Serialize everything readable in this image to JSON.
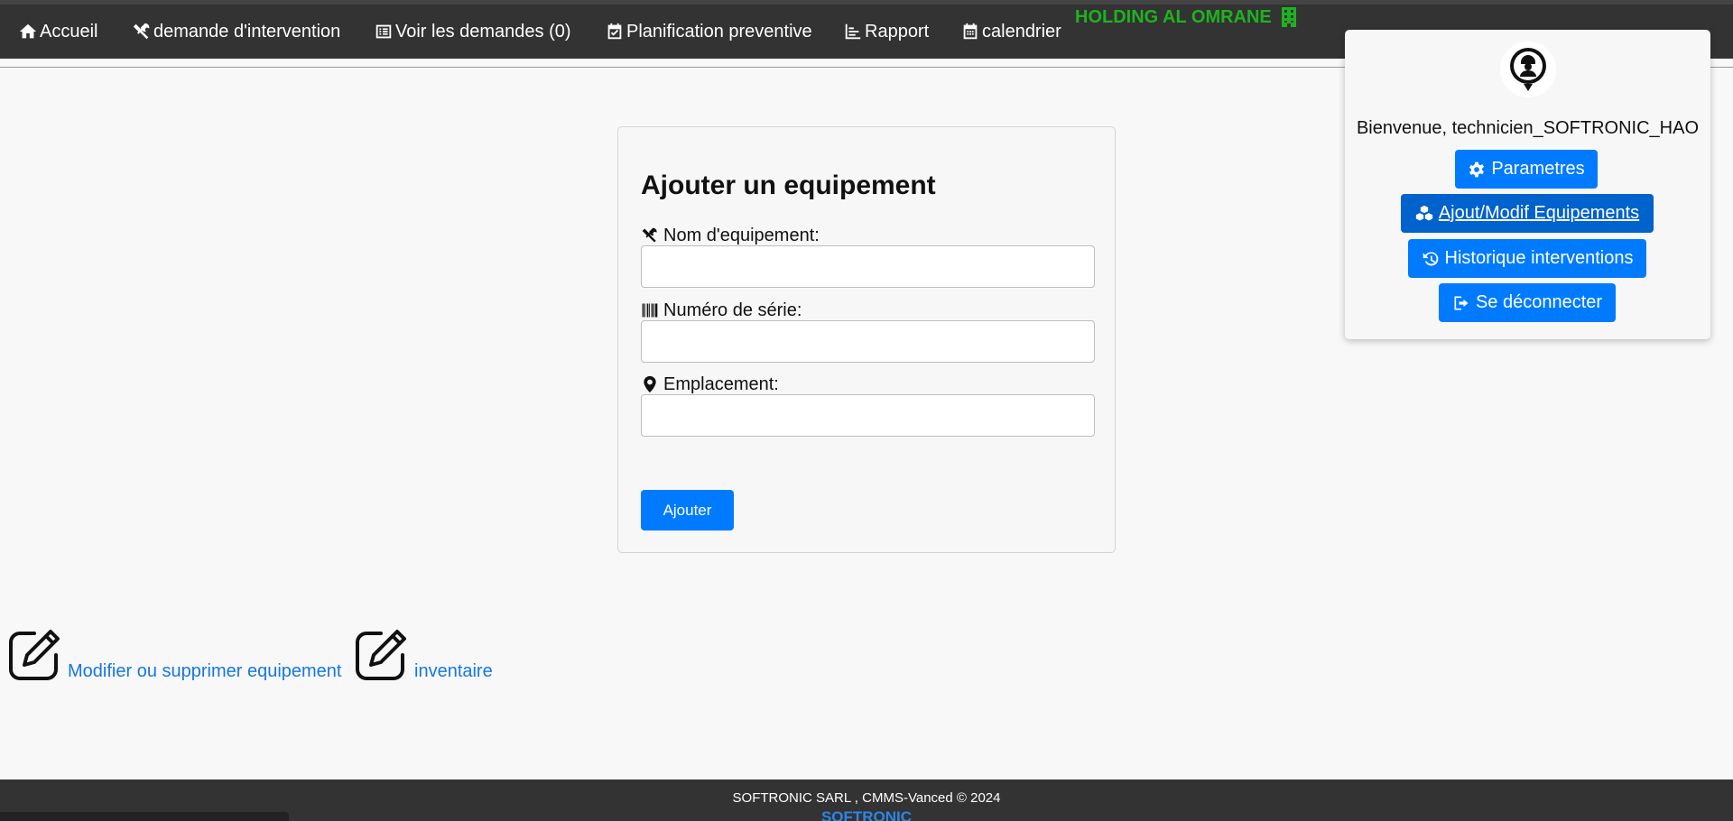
{
  "nav": {
    "items": [
      {
        "label": "Accueil",
        "icon": "home-icon"
      },
      {
        "label": "demande d'intervention",
        "icon": "tools-icon"
      },
      {
        "label": "Voir les demandes (0)",
        "icon": "list-icon"
      },
      {
        "label": "Planification preventive",
        "icon": "calendar-check-icon"
      },
      {
        "label": "Rapport",
        "icon": "chart-icon"
      },
      {
        "label": "calendrier",
        "icon": "calendar-icon"
      }
    ],
    "brand": "HOLDING AL OMRANE",
    "brand_icon": "building-icon"
  },
  "user_panel": {
    "avatar_icon": "technician-avatar-icon",
    "welcome": "Bienvenue, technicien_SOFTRONIC_HAO",
    "buttons": [
      {
        "label": "Parametres",
        "icon": "gear-icon"
      },
      {
        "label": "Ajout/Modif Equipements",
        "icon": "cubes-icon",
        "active": true
      },
      {
        "label": "Historique interventions",
        "icon": "history-icon"
      },
      {
        "label": "Se déconnecter",
        "icon": "logout-icon"
      }
    ]
  },
  "form": {
    "title": "Ajouter un equipement",
    "fields": [
      {
        "label": "Nom d'equipement:",
        "icon": "tools-icon",
        "value": ""
      },
      {
        "label": "Numéro de série:",
        "icon": "barcode-icon",
        "value": ""
      },
      {
        "label": "Emplacement:",
        "icon": "map-marker-icon",
        "value": ""
      }
    ],
    "submit_label": "Ajouter"
  },
  "links": [
    {
      "label": "Modifier ou supprimer equipement",
      "icon": "edit-icon"
    },
    {
      "label": "inventaire",
      "icon": "edit-icon"
    }
  ],
  "footer": {
    "text": "SOFTRONIC SARL , CMMS-Vanced © 2024",
    "logo": "SOFTRONIC"
  },
  "colors": {
    "nav_bg": "#333333",
    "brand_green": "#1fb21f",
    "primary": "#007bff",
    "primary_active": "#0062cc",
    "link": "#1577e6"
  }
}
